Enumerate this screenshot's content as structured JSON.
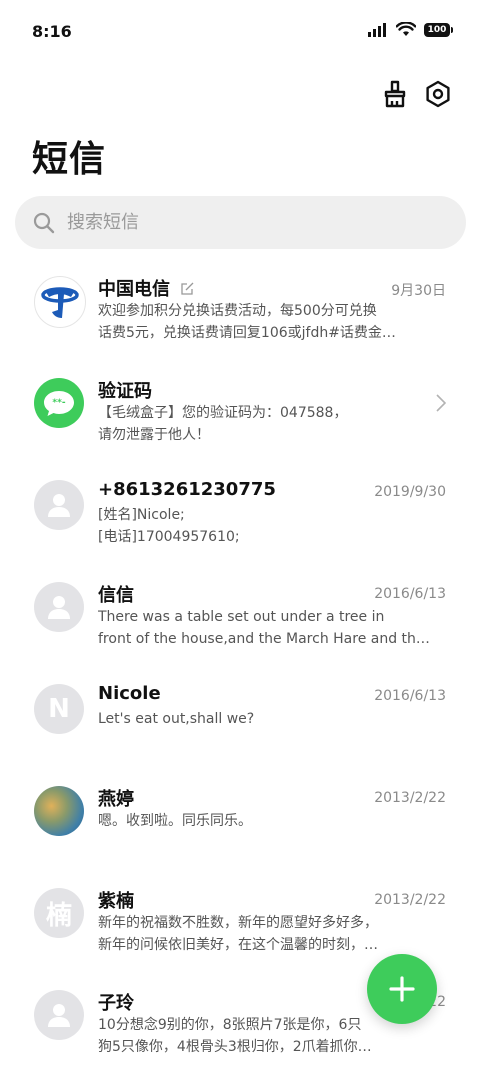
{
  "status_bar": {
    "time": "8:16",
    "battery": "100"
  },
  "header": {
    "title": "短信"
  },
  "search": {
    "placeholder": "搜索短信"
  },
  "conversations": [
    {
      "name": "中国电信",
      "date": "9月30日",
      "line1": "欢迎参加积分兑换话费活动，每500分可兑换",
      "line2": "话费5元，兑换话费请回复106或jfdh#话费金…",
      "avatar": "china-telecom-logo"
    },
    {
      "name": "验证码",
      "date": "",
      "line1": "【毛绒盒子】您的验证码为：047588，",
      "line2": "请勿泄露于他人！",
      "avatar": "verification-code-icon"
    },
    {
      "name": "+8613261230775",
      "date": "2019/9/30",
      "line1": "[姓名]Nicole;",
      "line2": "[电话]17004957610;",
      "avatar": "person-icon"
    },
    {
      "name": "信信",
      "date": "2016/6/13",
      "line1": "There was a table set out under a tree in",
      "line2": "front of the house,and the March Hare and th…",
      "avatar": "person-icon"
    },
    {
      "name": "Nicole",
      "date": "2016/6/13",
      "line1": "Let's eat out,shall we?",
      "line2": "",
      "avatar": "N"
    },
    {
      "name": "燕婷",
      "date": "2013/2/22",
      "line1": "嗯。收到啦。同乐同乐。",
      "line2": "",
      "avatar": "photo"
    },
    {
      "name": "紫楠",
      "date": "2013/2/22",
      "line1": "新年的祝福数不胜数，新年的愿望好多好多，",
      "line2": "新年的问候依旧美好，在这个温馨的时刻，…",
      "avatar": "楠"
    },
    {
      "name": "子玲",
      "date": "2013/2/22",
      "line1": "10分想念9别的你，8张照片7张是你，6只",
      "line2": "狗5只像你，4根骨头3根归你，2爪着抓你…",
      "avatar": "person-icon"
    }
  ],
  "colors": {
    "accent_green": "#3ecc5b",
    "telecom_blue": "#1c5bb8"
  }
}
